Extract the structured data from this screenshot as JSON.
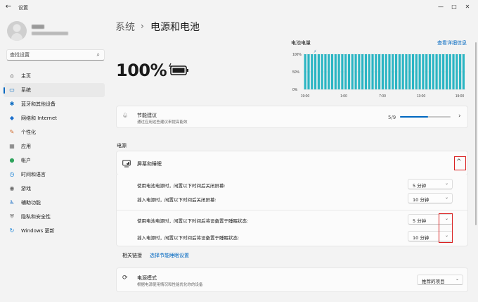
{
  "window": {
    "title": "设置",
    "back": "←",
    "min": "—",
    "max": "□",
    "close": "✕"
  },
  "search": {
    "placeholder": "查找设置"
  },
  "nav": [
    {
      "label": "主页",
      "icon": "home-icon",
      "glyph": "⌂",
      "color": "#555"
    },
    {
      "label": "系统",
      "icon": "system-icon",
      "glyph": "▭",
      "color": "#0067c0",
      "active": true
    },
    {
      "label": "蓝牙和其他设备",
      "icon": "bluetooth-icon",
      "glyph": "✱",
      "color": "#0067c0"
    },
    {
      "label": "网络和 Internet",
      "icon": "network-icon",
      "glyph": "◆",
      "color": "#1a6ecc"
    },
    {
      "label": "个性化",
      "icon": "personalize-icon",
      "glyph": "✎",
      "color": "#d16b2c"
    },
    {
      "label": "应用",
      "icon": "apps-icon",
      "glyph": "▦",
      "color": "#6b6b6b"
    },
    {
      "label": "帐户",
      "icon": "account-icon",
      "glyph": "●",
      "color": "#2fa35c"
    },
    {
      "label": "时间和语言",
      "icon": "time-language-icon",
      "glyph": "◷",
      "color": "#0a7bd5"
    },
    {
      "label": "游戏",
      "icon": "gaming-icon",
      "glyph": "◉",
      "color": "#6b6b6b"
    },
    {
      "label": "辅助功能",
      "icon": "accessibility-icon",
      "glyph": "♿",
      "color": "#1b6fc4"
    },
    {
      "label": "隐私和安全性",
      "icon": "privacy-icon",
      "glyph": "⛨",
      "color": "#6b6b6b"
    },
    {
      "label": "Windows 更新",
      "icon": "windows-update-icon",
      "glyph": "↻",
      "color": "#0a7bd5"
    }
  ],
  "breadcrumb": {
    "parent": "系统",
    "separator": "›",
    "current": "电源和电池"
  },
  "battery": {
    "percent": "100%",
    "charging": true
  },
  "usage": {
    "title": "电池电量",
    "link": "查看详细信息",
    "y_ticks": [
      "100%",
      "50%",
      "0%"
    ],
    "x_ticks": [
      "19:00",
      "1:00",
      "7:00",
      "13:00",
      "19:00"
    ]
  },
  "chart_data": {
    "type": "bar",
    "title": "电池电量",
    "ylim": [
      0,
      100
    ],
    "y_ticks": [
      "100%",
      "50%",
      "0%"
    ],
    "x_ticks": [
      "19:00",
      "1:00",
      "7:00",
      "13:00",
      "19:00"
    ],
    "values": [
      100,
      100,
      100,
      100,
      100,
      100,
      100,
      100,
      100,
      100,
      100,
      100,
      100,
      100,
      100,
      100,
      100,
      100,
      100,
      100,
      100,
      100,
      100,
      100,
      100,
      100,
      100,
      100,
      100,
      100,
      100,
      100,
      100,
      100,
      100,
      100,
      100,
      100,
      100,
      100,
      100,
      100,
      100,
      100,
      100,
      100,
      100,
      100
    ],
    "charging_marker": "⚡",
    "bar_color": "#2bb5c3"
  },
  "energy": {
    "title": "节能建议",
    "subtitle": "通过应用这些建议来提高能效",
    "count": "5/9",
    "progress_fraction": 0.556
  },
  "power_section": "电源",
  "screen_sleep": {
    "title": "屏幕和睡眠",
    "expand_glyph": "^",
    "settings": [
      {
        "label": "使用电池电源时，闲置以下时间后关闭屏幕:",
        "value": "5 分钟"
      },
      {
        "label": "插入电源时，闲置以下时间后关闭屏幕:",
        "value": "10 分钟"
      },
      {
        "label": "使用电池电源时，闲置以下时间后将设备置于睡眠状态:",
        "value": "5 分钟"
      },
      {
        "label": "插入电源时，闲置以下时间后将设备置于睡眠状态:",
        "value": "10 分钟"
      }
    ],
    "chevron": "⌄"
  },
  "related": {
    "label": "相关链接",
    "link": "选择节能睡眠设置"
  },
  "power_mode": {
    "title": "电源模式",
    "subtitle": "根据电源使用情况和性能优化你的设备",
    "value": "推荐的项目"
  },
  "colors": {
    "accent": "#0067c0",
    "highlight": "#d92020",
    "bar": "#2bb5c3"
  }
}
